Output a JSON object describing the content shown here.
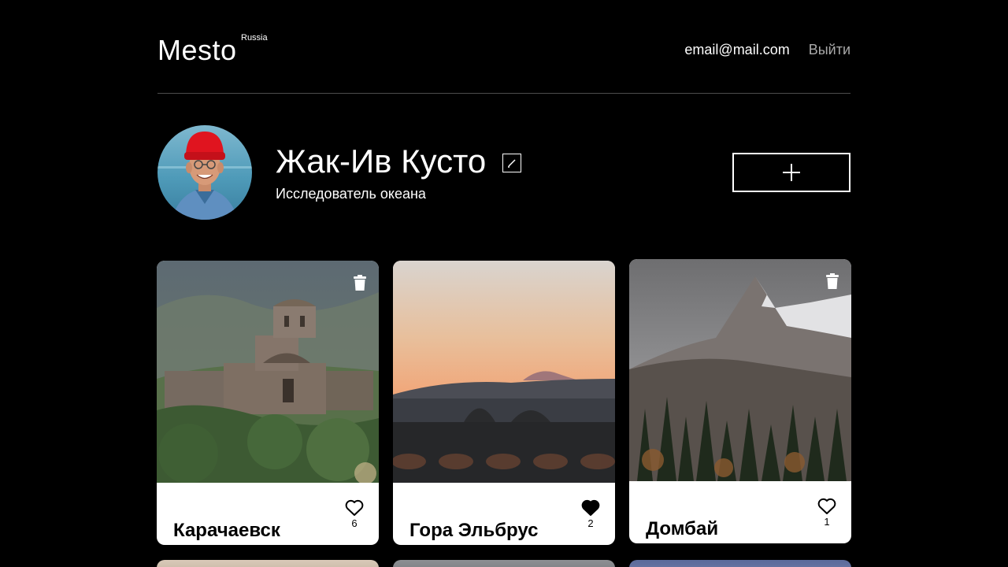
{
  "header": {
    "logo": "Mesto",
    "logo_sup": "Russia",
    "email": "email@mail.com",
    "logout": "Выйти"
  },
  "profile": {
    "name": "Жак-Ив Кусто",
    "about": "Исследователь океана"
  },
  "cards": [
    {
      "title": "Карачаевск",
      "likes": "6",
      "liked": false,
      "deletable": true
    },
    {
      "title": "Гора Эльбрус",
      "likes": "2",
      "liked": true,
      "deletable": false
    },
    {
      "title": "Домбай",
      "likes": "1",
      "liked": false,
      "deletable": true
    }
  ],
  "icons": {
    "edit": "pencil-icon",
    "add": "plus-icon",
    "delete": "trash-icon",
    "like": "heart-icon"
  },
  "colors": {
    "background": "#000000",
    "card_background": "#ffffff",
    "muted_text": "#a9a9a9"
  }
}
